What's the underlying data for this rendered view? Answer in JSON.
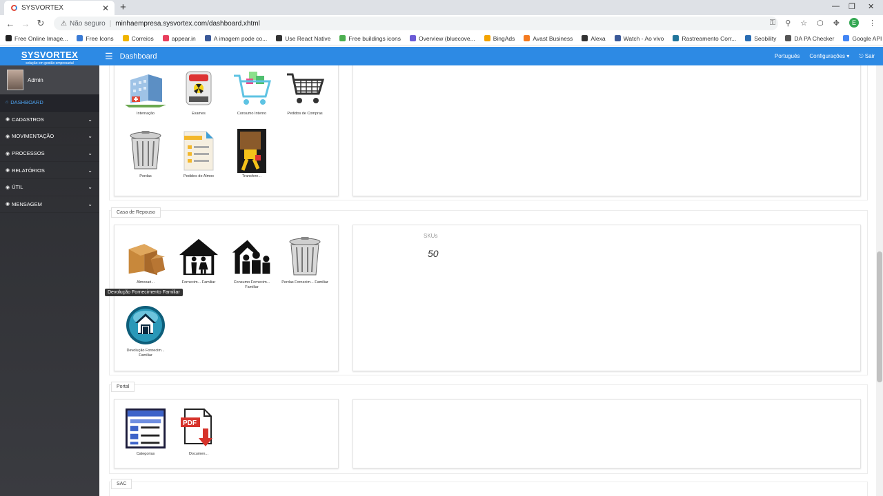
{
  "browser": {
    "tab_title": "SYSVORTEX",
    "insecure_label": "Não seguro",
    "url": "minhaempresa.sysvortex.com/dashboard.xhtml",
    "profile_initial": "E",
    "bookmarks": [
      {
        "label": "Free Online Image...",
        "color": "#222"
      },
      {
        "label": "Free Icons",
        "color": "#3a7bd5"
      },
      {
        "label": "Correios",
        "color": "#f0b400"
      },
      {
        "label": "appear.in",
        "color": "#e83e5c"
      },
      {
        "label": "A imagem pode co...",
        "color": "#3b5998"
      },
      {
        "label": "Use React Native",
        "color": "#333"
      },
      {
        "label": "Free buildings icons",
        "color": "#4caf50"
      },
      {
        "label": "Overview (bluecove...",
        "color": "#6b5bd6"
      },
      {
        "label": "BingAds",
        "color": "#f4a300"
      },
      {
        "label": "Avast Business",
        "color": "#f47b20"
      },
      {
        "label": "Alexa",
        "color": "#333"
      },
      {
        "label": "Watch - Ao vivo",
        "color": "#3b5998"
      },
      {
        "label": "Rastreamento Corr...",
        "color": "#21759b"
      },
      {
        "label": "Seobility",
        "color": "#2a6db3"
      },
      {
        "label": "DA PA Checker",
        "color": "#555"
      },
      {
        "label": "Google API",
        "color": "#4285f4"
      }
    ]
  },
  "header": {
    "logo_main": "SYSVORTEX",
    "logo_sub": "solução em gestão empresarial",
    "page_title": "Dashboard",
    "language": "Português",
    "settings": "Configurações ▾",
    "logout": "⎋ Sair"
  },
  "sidebar": {
    "user_name": "Admin",
    "items": [
      {
        "label": "DASHBOARD",
        "active": true
      },
      {
        "label": "CADASTROS"
      },
      {
        "label": "MOVIMENTAÇÃO"
      },
      {
        "label": "PROCESSOS"
      },
      {
        "label": "RELATÓRIOS"
      },
      {
        "label": "ÚTIL"
      },
      {
        "label": "MENSAGEM"
      }
    ]
  },
  "sections": {
    "top": {
      "tiles": [
        {
          "label": "Internação",
          "icon": "hospital-icon"
        },
        {
          "label": "Exames",
          "icon": "xray-machine-icon"
        },
        {
          "label": "Consumo Interno",
          "icon": "shopping-cart-icon"
        },
        {
          "label": "Pedidos de Compras",
          "icon": "shopping-cart-icon"
        },
        {
          "label": "Perdas",
          "icon": "trash-can-icon"
        },
        {
          "label": "Pedidos de Almox",
          "icon": "document-icon"
        },
        {
          "label": "Transfere...",
          "icon": "person-carrying-box-icon"
        }
      ]
    },
    "casa": {
      "label": "Casa de Repouso",
      "tiles": [
        {
          "label": "Almoxari...",
          "icon": "boxes-icon"
        },
        {
          "label": "Fornecim... Familiar",
          "icon": "family-house-icon"
        },
        {
          "label": "Consumo Fornecim... Familiar",
          "icon": "family-house-icon"
        },
        {
          "label": "Perdas Fornecim... Familiar",
          "icon": "trash-can-icon"
        },
        {
          "label": "Devolução Fornecim... Familiar",
          "icon": "home-button-icon"
        }
      ],
      "tooltip": "Devolução Fornecimento Familiar",
      "kpi_label": "SKUs",
      "kpi_value": "50"
    },
    "portal": {
      "label": "Portal",
      "tiles": [
        {
          "label": "Categorias",
          "icon": "form-window-icon"
        },
        {
          "label": "Documen...",
          "icon": "pdf-download-icon"
        }
      ]
    },
    "sac": {
      "label": "SAC"
    }
  }
}
